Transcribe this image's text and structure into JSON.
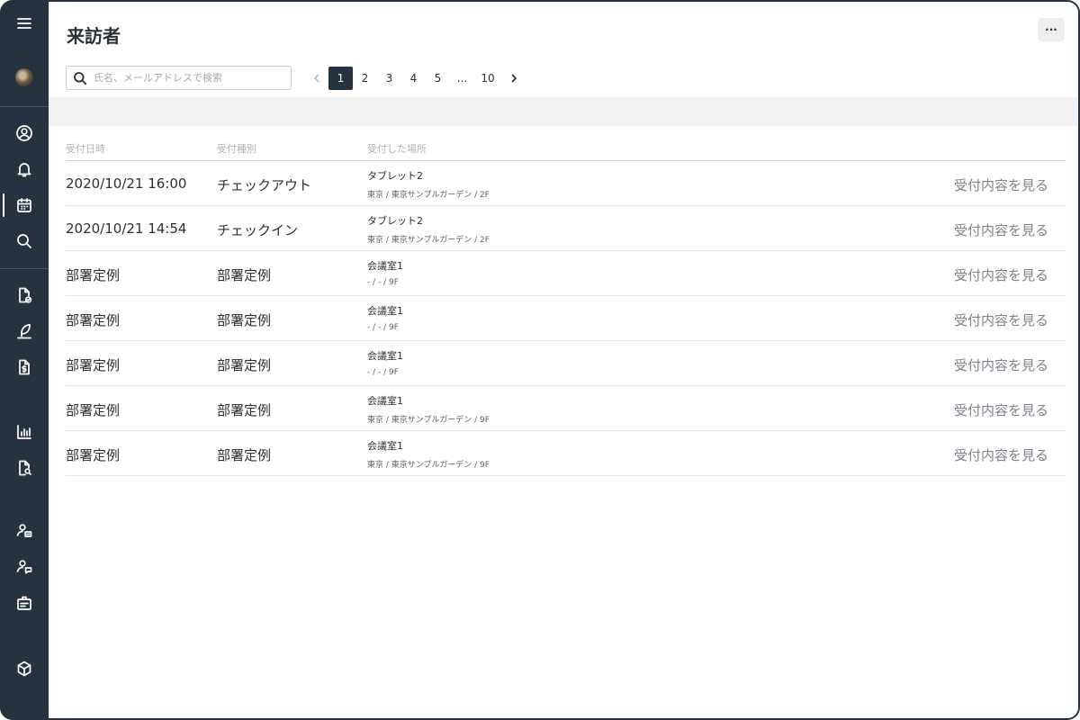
{
  "sidebar": {
    "menu_icon": "hamburger-icon",
    "items": [
      {
        "icon": "user-circle-icon"
      },
      {
        "icon": "bell-icon"
      },
      {
        "icon": "calendar-icon",
        "active": true
      },
      {
        "icon": "search-icon"
      },
      {
        "icon": "document-check-icon"
      },
      {
        "icon": "feather-icon"
      },
      {
        "icon": "invoice-dollar-icon"
      },
      {
        "icon": "bar-chart-icon"
      },
      {
        "icon": "document-search-icon"
      },
      {
        "icon": "user-card-icon"
      },
      {
        "icon": "user-chat-icon"
      },
      {
        "icon": "id-badge-icon"
      },
      {
        "icon": "cube-icon"
      }
    ]
  },
  "header": {
    "title": "来訪者",
    "more_label": "···"
  },
  "search": {
    "placeholder": "氏名、メールアドレスで検索",
    "value": ""
  },
  "pagination": {
    "pages": [
      "1",
      "2",
      "3",
      "4",
      "5",
      "...",
      "10"
    ],
    "current": "1"
  },
  "table": {
    "headers": {
      "date": "受付日時",
      "type": "受付種別",
      "place": "受付した場所"
    },
    "rows": [
      {
        "date": "2020/10/21 16:00",
        "type": "チェックアウト",
        "place": "タブレット2",
        "location": "東京 / 東京サンプルガーデン / 2F",
        "action": "受付内容を見る"
      },
      {
        "date": "2020/10/21 14:54",
        "type": "チェックイン",
        "place": "タブレット2",
        "location": "東京 / 東京サンプルガーデン / 2F",
        "action": "受付内容を見る"
      },
      {
        "date": "部署定例",
        "type": "部署定例",
        "place": "会議室1",
        "location": "- / - / 9F",
        "action": "受付内容を見る"
      },
      {
        "date": "部署定例",
        "type": "部署定例",
        "place": "会議室1",
        "location": "- / - / 9F",
        "action": "受付内容を見る"
      },
      {
        "date": "部署定例",
        "type": "部署定例",
        "place": "会議室1",
        "location": "- / - / 9F",
        "action": "受付内容を見る"
      },
      {
        "date": "部署定例",
        "type": "部署定例",
        "place": "会議室1",
        "location": "東京 / 東京サンプルガーデン / 9F",
        "action": "受付内容を見る"
      },
      {
        "date": "部署定例",
        "type": "部署定例",
        "place": "会議室1",
        "location": "東京 / 東京サンプルガーデン / 9F",
        "action": "受付内容を見る"
      }
    ]
  }
}
